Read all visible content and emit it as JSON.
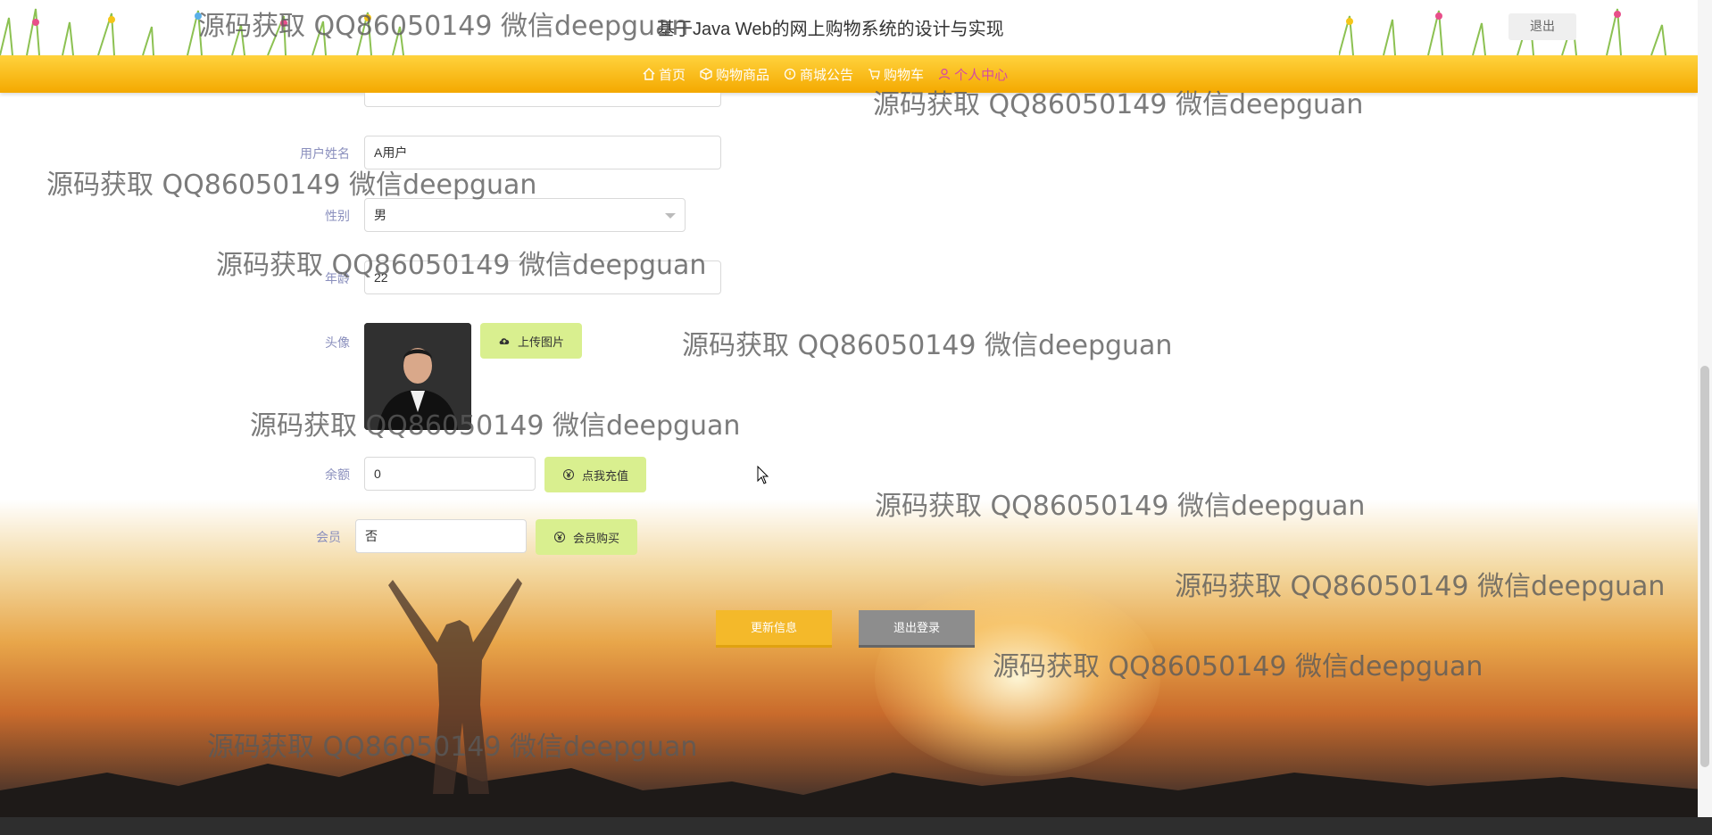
{
  "header": {
    "site_title": "基于Java Web的网上购物系统的设计与实现",
    "logout_label": "退出"
  },
  "nav": {
    "items": [
      {
        "label": "首页",
        "icon": "home-icon"
      },
      {
        "label": "购物商品",
        "icon": "box-icon"
      },
      {
        "label": "商城公告",
        "icon": "notice-icon"
      },
      {
        "label": "购物车",
        "icon": "cart-icon"
      },
      {
        "label": "个人中心",
        "icon": "user-icon"
      }
    ],
    "active": "个人中心"
  },
  "form": {
    "name": {
      "label": "用户姓名",
      "value": "A用户"
    },
    "gender": {
      "label": "性别",
      "value": "男"
    },
    "age": {
      "label": "年龄",
      "value": "22"
    },
    "avatar": {
      "label": "头像",
      "upload_label": "上传图片"
    },
    "balance": {
      "label": "余额",
      "value": "0",
      "recharge_label": "点我充值"
    },
    "member": {
      "label": "会员",
      "value": "否",
      "buy_label": "会员购买"
    }
  },
  "actions": {
    "update_label": "更新信息",
    "logout_label": "退出登录"
  },
  "watermark": "源码获取 QQ86050149 微信deepguan",
  "colors": {
    "nav_bg": "#f4a900",
    "active": "#d64aa1",
    "green_btn": "#d9ef8f",
    "update_btn": "#f4b92a"
  }
}
